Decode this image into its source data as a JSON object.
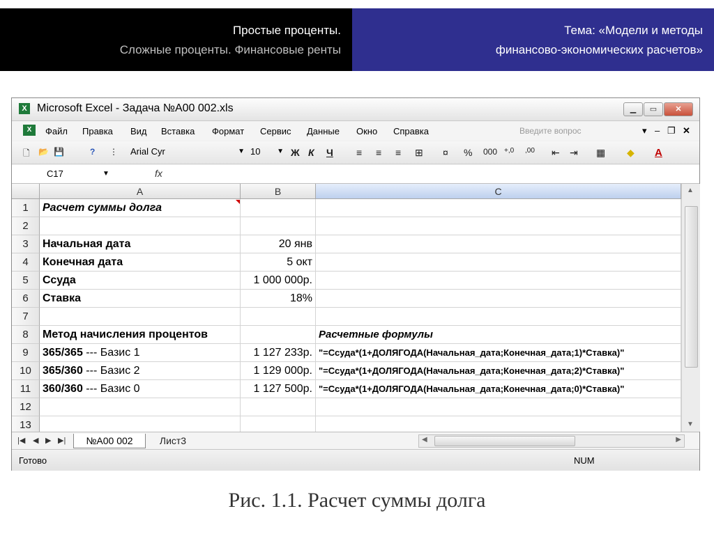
{
  "slide": {
    "header_left": {
      "line1": "Простые проценты.",
      "line2": "Сложные проценты. Финансовые ренты"
    },
    "header_right": {
      "line1": "Тема: «Модели и методы",
      "line2": "финансово-экономических расчетов»"
    },
    "caption": "Рис. 1.1. Расчет суммы долга"
  },
  "excel": {
    "title": "Microsoft Excel - Задача №А00 002.xls",
    "menu": [
      "Файл",
      "Правка",
      "Вид",
      "Вставка",
      "Формат",
      "Сервис",
      "Данные",
      "Окно",
      "Справка"
    ],
    "ask_placeholder": "Введите вопрос",
    "font_name": "Arial Cyr",
    "font_size": "10",
    "toolbar_text": {
      "bold": "Ж",
      "italic": "К",
      "underline": "Ч",
      "percent": "%",
      "thousands": "000",
      "inc_decimal": "+,0",
      "dec_decimal": ",00"
    },
    "name_box": "C17",
    "fx_label": "fx",
    "columns": [
      "A",
      "B",
      "C"
    ],
    "rows": [
      {
        "n": "1",
        "a": "Расчет суммы долга",
        "b": "",
        "c": ""
      },
      {
        "n": "2",
        "a": "",
        "b": "",
        "c": ""
      },
      {
        "n": "3",
        "a": "Начальная дата",
        "b": "20 янв",
        "c": ""
      },
      {
        "n": "4",
        "a": "Конечная дата",
        "b": "5 окт",
        "c": ""
      },
      {
        "n": "5",
        "a": "Ссуда",
        "b": "1 000 000р.",
        "c": ""
      },
      {
        "n": "6",
        "a": "Ставка",
        "b": "18%",
        "c": ""
      },
      {
        "n": "7",
        "a": "",
        "b": "",
        "c": ""
      },
      {
        "n": "8",
        "a": "Метод начисления процентов",
        "b": "",
        "c": "Расчетные формулы"
      },
      {
        "n": "9",
        "a_bold": "365/365",
        "a_rest": " --- Базис 1",
        "b": "1 127 233р.",
        "c": "\"=Ссуда*(1+ДОЛЯГОДА(Начальная_дата;Конечная_дата;1)*Ставка)\""
      },
      {
        "n": "10",
        "a_bold": "365/360",
        "a_rest": " --- Базис 2",
        "b": "1 129 000р.",
        "c": "\"=Ссуда*(1+ДОЛЯГОДА(Начальная_дата;Конечная_дата;2)*Ставка)\""
      },
      {
        "n": "11",
        "a_bold": "360/360",
        "a_rest": " --- Базис 0",
        "b": "1 127 500р.",
        "c": "\"=Ссуда*(1+ДОЛЯГОДА(Начальная_дата;Конечная_дата;0)*Ставка)\""
      },
      {
        "n": "12",
        "a": "",
        "b": "",
        "c": ""
      },
      {
        "n": "13",
        "a": "",
        "b": "",
        "c": ""
      }
    ],
    "sheets": [
      "№А00 002",
      "Лист3"
    ],
    "status_left": "Готово",
    "status_num": "NUM"
  }
}
